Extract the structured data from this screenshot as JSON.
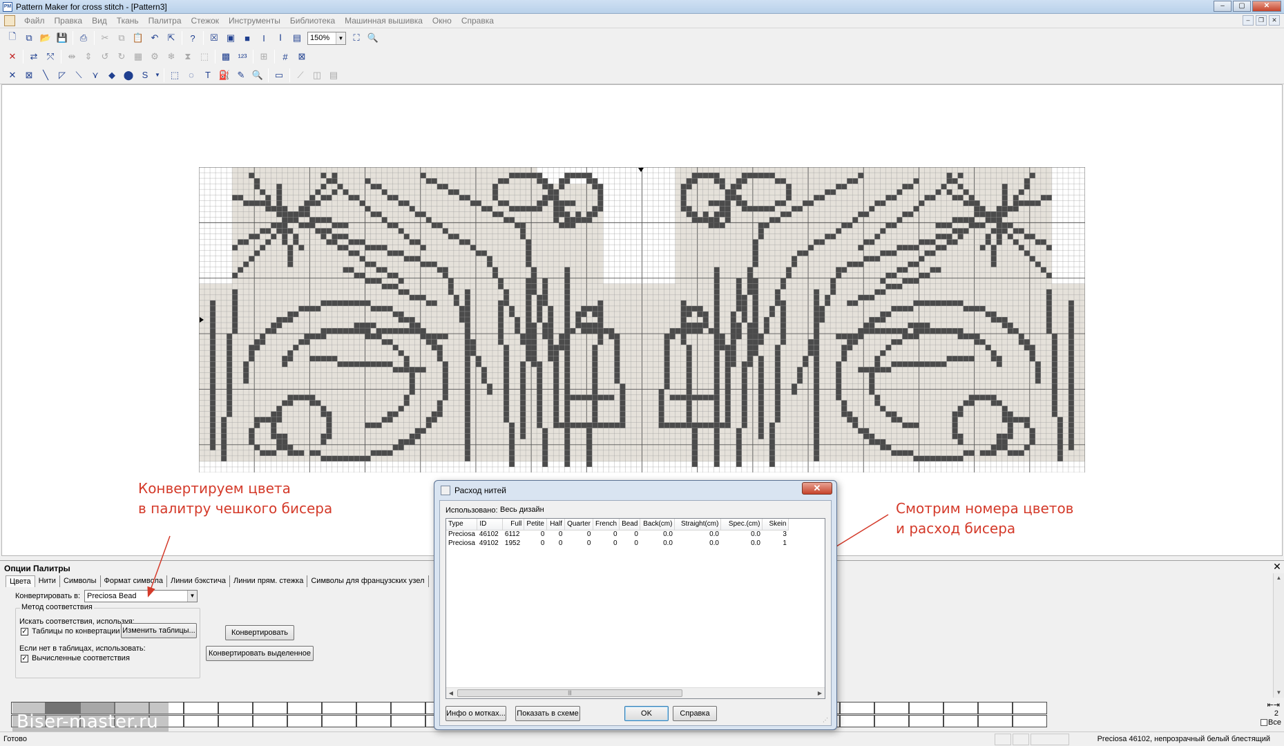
{
  "window": {
    "app_icon_label": "PM",
    "title": "Pattern Maker for cross stitch - [Pattern3]"
  },
  "menu": [
    "Файл",
    "Правка",
    "Вид",
    "Ткань",
    "Палитра",
    "Стежок",
    "Инструменты",
    "Библиотека",
    "Машинная вышивка",
    "Окно",
    "Справка"
  ],
  "toolbar": {
    "zoom_value": "150%",
    "row3_text_tools": {
      "text": "T",
      "stitch_s": "S",
      "italic_i": "I"
    }
  },
  "pattern": {
    "colors": {
      "background": "#e5e1da",
      "stitch": "#4b4b4b",
      "grid": "#9a9a9a",
      "grid_major": "#555555",
      "empty": "#ffffff"
    }
  },
  "annotations": {
    "left_line1": "Конвертируем цвета",
    "left_line2": "в палитру чешкого бисера",
    "right_line1": "Смотрим номера цветов",
    "right_line2": "и расход бисера",
    "color": "#d43a2a"
  },
  "palette_options": {
    "title": "Опции Палитры",
    "tabs": [
      "Цвета",
      "Нити",
      "Символы",
      "Формат символа",
      "Линии бэкстича",
      "Линии прям. стежка",
      "Символы для французских узел"
    ],
    "convert_to_label": "Конвертировать в:",
    "convert_to_value": "Preciosa Bead",
    "match_method_legend": "Метод соответствия",
    "search_using_label": "Искать соответствия, используя:",
    "conversion_tables_label": "Таблицы по конвертации",
    "conversion_tables_checked": true,
    "edit_tables_button": "Изменить таблицы...",
    "if_not_in_tables_label": "Если нет в таблицах, использовать:",
    "computed_matches_label": "Вычисленные соответствия",
    "computed_matches_checked": true,
    "convert_button": "Конвертировать",
    "convert_selected_button": "Конвертировать выделенное"
  },
  "palette_strip": {
    "watermark": "Biser-master.ru",
    "page_number": "2",
    "all_label": "Все"
  },
  "statusbar": {
    "left": "Готово",
    "right": "Preciosa  46102, непрозрачный белый блестящий"
  },
  "dialog": {
    "title": "Расход нитей",
    "used_label": "Использовано:",
    "used_value": "Весь дизайн",
    "columns": [
      "Type",
      "ID",
      "Full",
      "Petite",
      "Half",
      "Quarter",
      "French",
      "Bead",
      "Back(cm)",
      "Straight(cm)",
      "Spec.(cm)",
      "Skein"
    ],
    "rows": [
      [
        "Preciosa",
        "46102",
        "6112",
        "0",
        "0",
        "0",
        "0",
        "0",
        "0.0",
        "0.0",
        "0.0",
        "3"
      ],
      [
        "Preciosa",
        "49102",
        "1952",
        "0",
        "0",
        "0",
        "0",
        "0",
        "0.0",
        "0.0",
        "0.0",
        "1"
      ]
    ],
    "buttons": {
      "skein_info": "Инфо о мотках...",
      "show_in_pattern": "Показать в схеме",
      "ok": "OK",
      "help": "Справка"
    }
  }
}
